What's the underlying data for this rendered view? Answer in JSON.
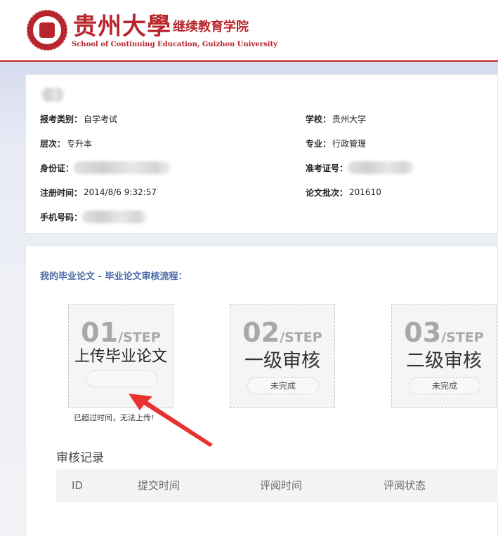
{
  "header": {
    "logo_cn": "贵州大學",
    "logo_cn_sub": "继续教育学院",
    "logo_en": "School of Continuing Education, Guizhou University"
  },
  "profile": {
    "fields_left": [
      {
        "label": "报考类别：",
        "value": "自学考试"
      },
      {
        "label": "层次：",
        "value": "专升本"
      },
      {
        "label": "身份证：",
        "value": ""
      },
      {
        "label": "注册时间：",
        "value": "2014/8/6 9:32:57"
      },
      {
        "label": "手机号码：",
        "value": ""
      }
    ],
    "fields_right": [
      {
        "label": "学校：",
        "value": "贵州大学"
      },
      {
        "label": "专业：",
        "value": "行政管理"
      },
      {
        "label": "准考证号：",
        "value": ""
      },
      {
        "label": "论文批次：",
        "value": "201610"
      }
    ]
  },
  "process": {
    "title": "我的毕业论文 - 毕业论文审核流程：",
    "steps": [
      {
        "num": "01",
        "suffix": "/STEP",
        "name": "上传毕业论文",
        "status": ""
      },
      {
        "num": "02",
        "suffix": "/STEP",
        "name": "一级审核",
        "status": "未完成"
      },
      {
        "num": "03",
        "suffix": "/STEP",
        "name": "二级审核",
        "status": "未完成"
      }
    ],
    "upload_note": "已超过时间，无法上传!",
    "colors": {
      "arrow": "#e8322f",
      "title": "#4a6aa8"
    }
  },
  "records": {
    "title": "审核记录",
    "columns": [
      "ID",
      "提交时间",
      "评阅时间",
      "评阅状态"
    ]
  }
}
